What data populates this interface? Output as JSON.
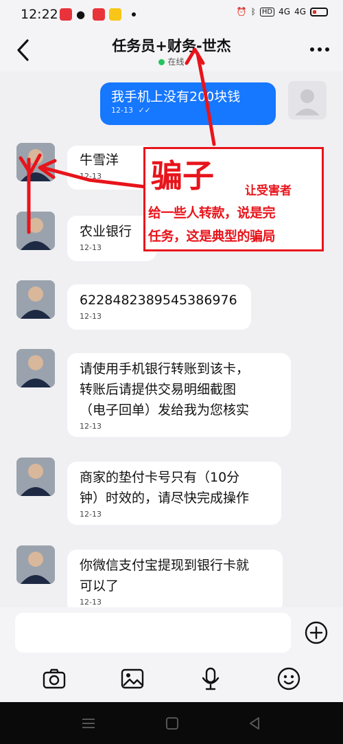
{
  "status_bar": {
    "time": "12:22",
    "network": "4G",
    "network2": "4G",
    "hd": "HD"
  },
  "header": {
    "title": "任务员+财务-世杰",
    "status": "在线"
  },
  "outgoing": {
    "text": "我手机上没有200块钱",
    "time": "12-13"
  },
  "messages": [
    {
      "lines": [
        "牛雪洋"
      ],
      "time": "12-13"
    },
    {
      "lines": [
        "农业银行"
      ],
      "time": "12-13"
    },
    {
      "lines": [
        "6228482389545386976"
      ],
      "time": "12-13"
    },
    {
      "lines": [
        "请使用手机银行转账到该卡，",
        "转账后请提供交易明细截图",
        "（电子回单）发给我为您核实"
      ],
      "time": "12-13"
    },
    {
      "lines": [
        "商家的垫付卡号只有（10分",
        "钟）时效的，请尽快完成操作"
      ],
      "time": "12-13"
    },
    {
      "lines": [
        "你微信支付宝提现到银行卡就",
        "可以了"
      ],
      "time": "12-13"
    }
  ],
  "annotation": {
    "title": "骗子",
    "sub": "让受害者",
    "line1": "给一些人转款，说是完",
    "line2": "任务，这是典型的骗局",
    "color": "#e8141b"
  },
  "input": {
    "placeholder": ""
  },
  "colors": {
    "accent": "#1677ff",
    "online": "#22c55e"
  },
  "icons": [
    "back-icon",
    "more-icon",
    "plus-icon",
    "camera-icon",
    "image-icon",
    "microphone-icon",
    "emoji-icon"
  ]
}
